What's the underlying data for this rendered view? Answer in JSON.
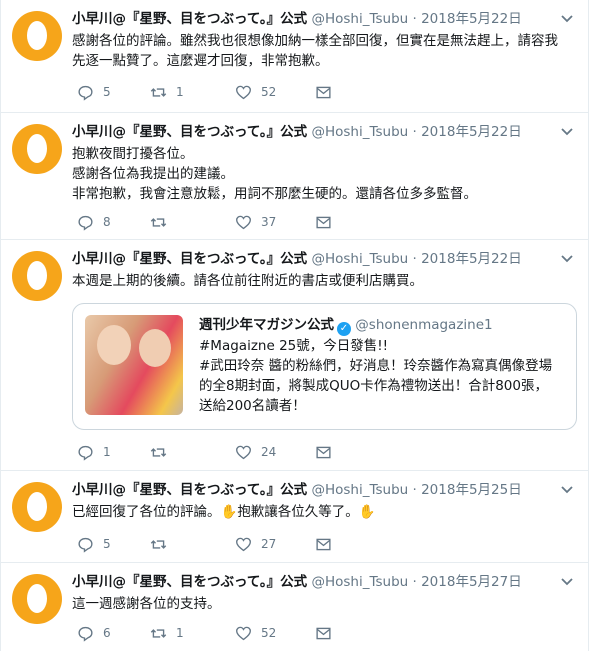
{
  "author": {
    "name": "小早川@『星野、目をつぶって。』公式",
    "handle": "@Hoshi_Tsubu",
    "separator": "·"
  },
  "colors": {
    "avatar_bg": "#f6a51a",
    "icon_gray": "#657786",
    "verified_blue": "#1da1f2"
  },
  "tweets": [
    {
      "date": "2018年5月22日",
      "lines": [
        "感謝各位的評論。雖然我也很想像加納一樣全部回復，但實在是無法趕上，請容我",
        "先逐一點贊了。這麼遲才回復，非常抱歉。"
      ],
      "replies": "5",
      "retweets": "1",
      "likes": "52"
    },
    {
      "date": "2018年5月22日",
      "lines": [
        "抱歉夜間打擾各位。",
        "感謝各位為我提出的建議。",
        "非常抱歉，我會注意放鬆，用詞不那麼生硬的。還請各位多多監督。"
      ],
      "replies": "8",
      "retweets": "",
      "likes": "37"
    },
    {
      "date": "2018年5月22日",
      "lines": [
        "本週是上期的後續。請各位前往附近的書店或便利店購買。"
      ],
      "replies": "1",
      "retweets": "",
      "likes": "24",
      "quote": {
        "name": "週刊少年マガジン公式",
        "verified_mark": "✓",
        "handle": "@shonenmagazine1",
        "lines": [
          "#Magaizne 25號，今日發售!!",
          "#武田玲奈 醬的粉絲們，好消息！玲奈醬作為寫真偶像登場",
          "的全8期封面，將製成QUO卡作為禮物送出！合計800張，",
          "送給200名讀者！"
        ]
      }
    },
    {
      "date": "2018年5月25日",
      "text_before": "已經回復了各位的評論。",
      "emoji_1": "✋",
      "text_middle": "抱歉讓各位久等了。",
      "emoji_2": "✋",
      "replies": "5",
      "retweets": "",
      "likes": "27"
    },
    {
      "date": "2018年5月27日",
      "lines": [
        "這一週感謝各位的支持。"
      ],
      "replies": "6",
      "retweets": "1",
      "likes": "52"
    }
  ]
}
